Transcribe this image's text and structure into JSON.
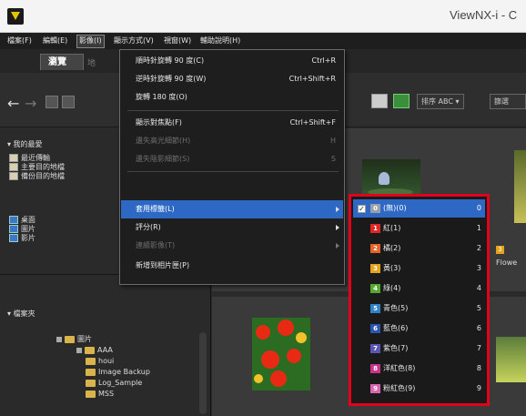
{
  "window": {
    "title": "ViewNX-i - C"
  },
  "menubar": {
    "items": [
      "檔案(F)",
      "編輯(E)",
      "影像(I)",
      "顯示方式(V)",
      "視窗(W)",
      "輔助說明(H)"
    ]
  },
  "tabs": {
    "browse": "瀏覽",
    "map": "地"
  },
  "toolbar": {
    "back": "←",
    "forward": "→",
    "sort_label": "排序 ABC ▾",
    "right_label": "篩選"
  },
  "left_panel": {
    "favorites_header": "▾ 我的最愛",
    "favorites": [
      "最近傳輸",
      "主要目的地檔",
      "備份目的地檔"
    ],
    "special": [
      "桌面",
      "圖片",
      "影片"
    ],
    "folders_header": "▾ 檔案夾",
    "tree": [
      "圖片",
      "AAA",
      "houi",
      "Image Backup",
      "Log_Sample",
      "MSS"
    ]
  },
  "image_menu": {
    "items": [
      {
        "label": "順時針旋轉 90 度(C)",
        "shortcut": "Ctrl+R",
        "disabled": false
      },
      {
        "label": "逆時針旋轉 90 度(W)",
        "shortcut": "Ctrl+Shift+R",
        "disabled": false
      },
      {
        "label": "旋轉 180 度(O)",
        "shortcut": "",
        "disabled": false
      },
      {
        "label": "顯示對焦點(F)",
        "shortcut": "Ctrl+Shift+F",
        "disabled": false
      },
      {
        "label": "遺失高光細節(H)",
        "shortcut": "H",
        "disabled": true
      },
      {
        "label": "遺失陰影細節(S)",
        "shortcut": "S",
        "disabled": true
      },
      {
        "label": "套用標籤(L)",
        "shortcut": "",
        "disabled": false,
        "highlight": true,
        "submenu": true
      },
      {
        "label": "評分(R)",
        "shortcut": "",
        "disabled": false,
        "submenu": true
      },
      {
        "label": "連續影像(T)",
        "shortcut": "",
        "disabled": true,
        "submenu": true
      },
      {
        "label": "新增到相片匣(P)",
        "shortcut": "",
        "disabled": false
      }
    ]
  },
  "label_submenu": {
    "items": [
      {
        "num": "0",
        "name": "(無)(0)",
        "color": "#9aa0a8",
        "checked": true
      },
      {
        "num": "1",
        "name": "紅(1)",
        "color": "#e02626"
      },
      {
        "num": "2",
        "name": "橘(2)",
        "color": "#e5632a"
      },
      {
        "num": "3",
        "name": "黃(3)",
        "color": "#e5a21b"
      },
      {
        "num": "4",
        "name": "綠(4)",
        "color": "#57a833"
      },
      {
        "num": "5",
        "name": "青色(5)",
        "color": "#2f82c8"
      },
      {
        "num": "6",
        "name": "藍色(6)",
        "color": "#2a56b0"
      },
      {
        "num": "7",
        "name": "紫色(7)",
        "color": "#5a55b3"
      },
      {
        "num": "8",
        "name": "洋紅色(8)",
        "color": "#c8348a"
      },
      {
        "num": "9",
        "name": "粉紅色(9)",
        "color": "#d966b0"
      }
    ],
    "highlight_border": "#e3001b"
  },
  "content": {
    "thumb_label_num": "3",
    "thumb_caption": "Flowe"
  }
}
